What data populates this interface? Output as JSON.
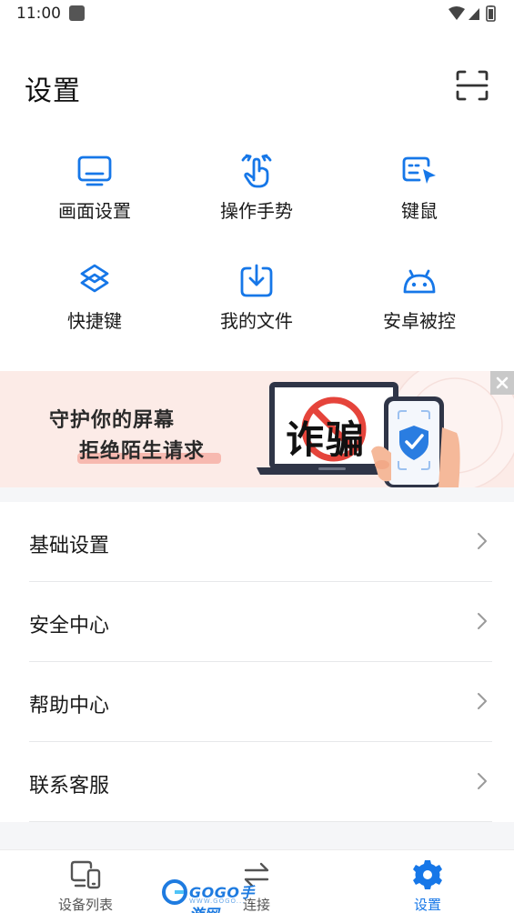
{
  "status_bar": {
    "time": "11:00"
  },
  "header": {
    "title": "设置"
  },
  "grid": {
    "items": [
      {
        "label": "画面设置",
        "icon": "monitor-icon"
      },
      {
        "label": "操作手势",
        "icon": "hand-gesture-icon"
      },
      {
        "label": "键鼠",
        "icon": "keyboard-mouse-icon"
      },
      {
        "label": "快捷键",
        "icon": "layers-shortcut-icon"
      },
      {
        "label": "我的文件",
        "icon": "download-file-icon"
      },
      {
        "label": "安卓被控",
        "icon": "android-icon"
      }
    ]
  },
  "banner": {
    "line1": "守护你的屏幕",
    "line2": "拒绝陌生请求",
    "laptop_text": "诈骗"
  },
  "list": {
    "items": [
      {
        "label": "基础设置"
      },
      {
        "label": "安全中心"
      },
      {
        "label": "帮助中心"
      },
      {
        "label": "联系客服"
      }
    ]
  },
  "bottom_nav": {
    "items": [
      {
        "label": "设备列表",
        "icon": "devices-icon"
      },
      {
        "label": "连接",
        "icon": "swap-arrows-icon"
      },
      {
        "label": "设置",
        "icon": "gear-icon",
        "active": true
      }
    ]
  },
  "watermark": {
    "text": "GOGO手游网",
    "sub": "WWW.GOGO..."
  },
  "colors": {
    "accent": "#1677e8",
    "banner_bg": "#fcebe7",
    "text": "#1a1a1a",
    "divider": "#e7e8ea"
  }
}
